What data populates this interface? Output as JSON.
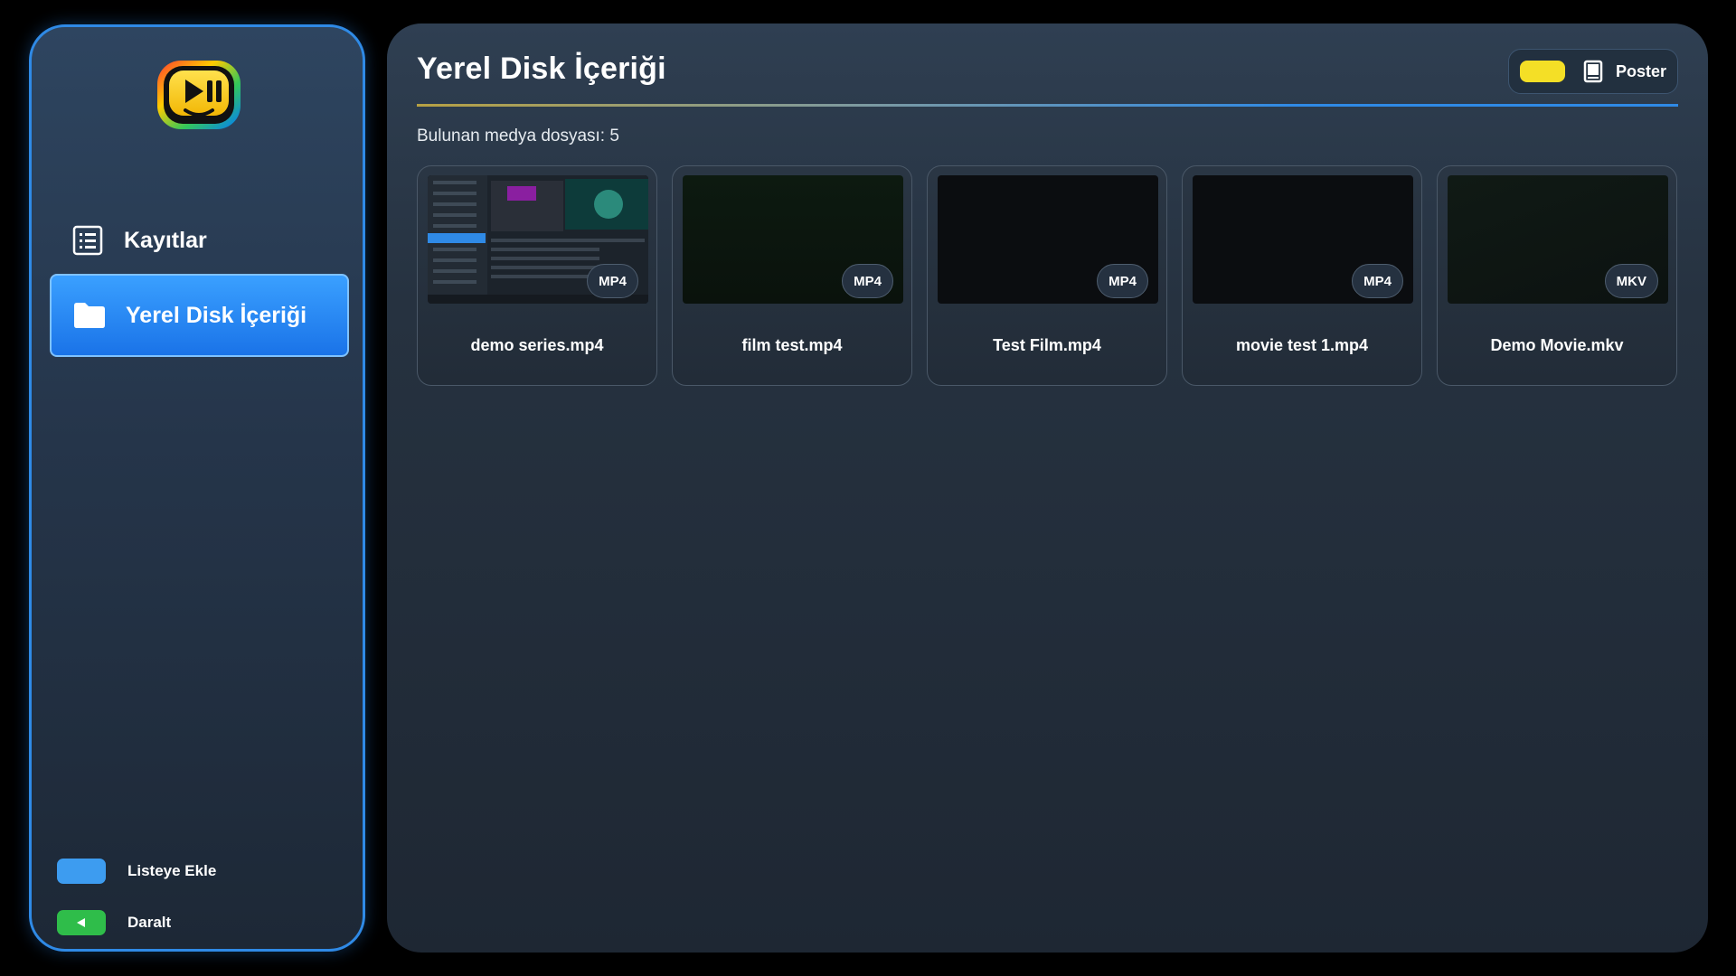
{
  "sidebar": {
    "logo_icon": "play-pause-tv-logo-icon",
    "items": [
      {
        "label": "Kayıtlar",
        "icon": "list-icon"
      },
      {
        "label": "Yerel Disk İçeriği",
        "icon": "folder-icon",
        "active": true
      }
    ],
    "legend": [
      {
        "label": "Listeye Ekle",
        "color": "#3d9cf0"
      },
      {
        "label": "Daralt",
        "color": "#2fbd4a",
        "icon": "triangle-left-icon"
      }
    ]
  },
  "main": {
    "title": "Yerel Disk İçeriği",
    "count_text": "Bulunan medya dosyası: 5",
    "view_toggle": {
      "label": "Poster",
      "icon": "poster-icon",
      "color": "#f4df26"
    },
    "items": [
      {
        "name": "demo series.mp4",
        "format": "MP4"
      },
      {
        "name": "film test.mp4",
        "format": "MP4"
      },
      {
        "name": "Test Film.mp4",
        "format": "MP4"
      },
      {
        "name": "movie test 1.mp4",
        "format": "MP4"
      },
      {
        "name": "Demo Movie.mkv",
        "format": "MKV"
      }
    ]
  },
  "colors": {
    "accent": "#2f8ae6",
    "active_item": "#1f7cf0",
    "panel": "#263240"
  }
}
